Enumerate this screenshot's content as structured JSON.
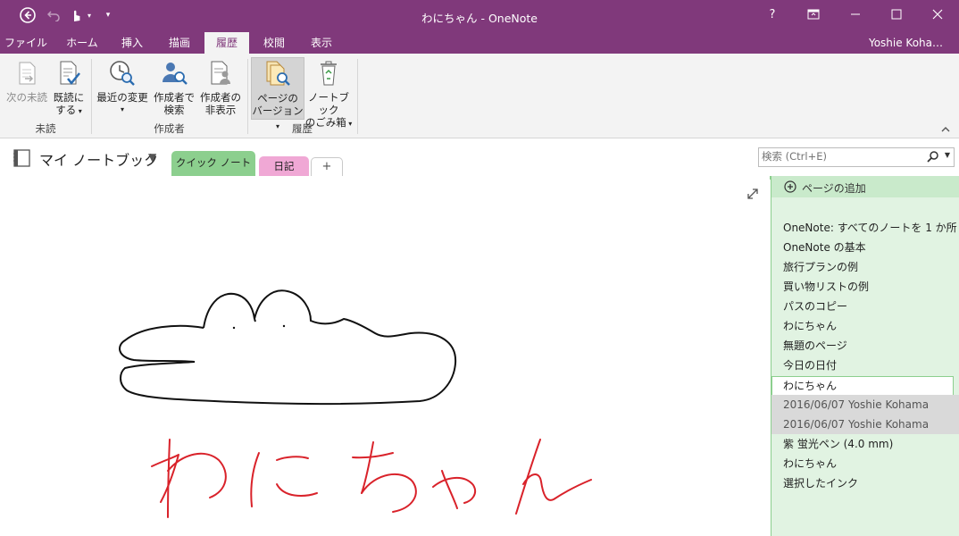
{
  "window": {
    "title": "わにちゃん - OneNote",
    "help": "?",
    "user": "Yoshie Koha…"
  },
  "ribbon_tabs": [
    "ファイル",
    "ホーム",
    "挿入",
    "描画",
    "履歴",
    "校閲",
    "表示"
  ],
  "active_tab": "履歴",
  "ribbon": {
    "next_unread": "次の未読",
    "mark_read_1": "既読に",
    "mark_read_2": "する",
    "recent_1": "最近の変更",
    "find_author_1": "作成者で",
    "find_author_2": "検索",
    "hide_author_1": "作成者の",
    "hide_author_2": "非表示",
    "page_versions_1": "ページの",
    "page_versions_2": "バージョン",
    "recycle_1": "ノートブック",
    "recycle_2": "のごみ箱",
    "group_unread": "未読",
    "group_authors": "作成者",
    "group_history": "履歴"
  },
  "notebook": {
    "name": "マイ ノートブック",
    "sections": [
      "クイック ノート",
      "日記"
    ],
    "add_section": "+",
    "search_placeholder": "検索 (Ctrl+E)"
  },
  "pages_pane": {
    "add_page": "ページの追加",
    "pages": [
      "OneNote: すべてのノートを 1 か所",
      "OneNote の基本",
      "旅行プランの例",
      "買い物リストの例",
      "パスのコピー",
      "わにちゃん",
      "無題のページ",
      "今日の日付"
    ],
    "selected_page": "わにちゃん",
    "versions": [
      "2016/06/07 Yoshie Kohama",
      "2016/06/07 Yoshie Kohama"
    ],
    "more_pages": [
      "紫 蛍光ペン (4.0 mm)",
      "わにちゃん",
      "選択したインク"
    ]
  },
  "colors": {
    "brand": "#80397b",
    "section_quick": "#8ccf8e",
    "section_diary": "#f0a8d5",
    "ink_red": "#d9222a"
  },
  "canvas": {
    "expand_icon": "expand-icon",
    "handwriting": "わにちゃん"
  }
}
